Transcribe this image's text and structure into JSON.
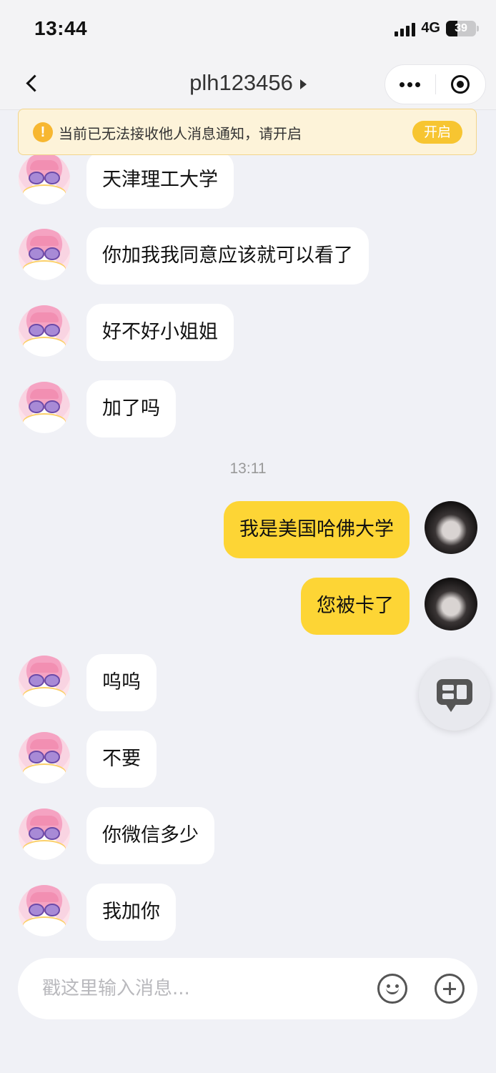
{
  "status_bar": {
    "time": "13:44",
    "network": "4G",
    "battery": "39"
  },
  "nav": {
    "title": "plh123456"
  },
  "notice": {
    "text": "当前已无法接收他人消息通知，请开启",
    "button": "开启"
  },
  "messages": [
    {
      "sender": "other",
      "text": "天津理工大学"
    },
    {
      "sender": "other",
      "text": "你加我我同意应该就可以看了"
    },
    {
      "sender": "other",
      "text": "好不好小姐姐"
    },
    {
      "sender": "other",
      "text": "加了吗"
    },
    {
      "sender": "self",
      "text": "我是美国哈佛大学"
    },
    {
      "sender": "self",
      "text": "您被卡了"
    },
    {
      "sender": "other",
      "text": "呜呜"
    },
    {
      "sender": "other",
      "text": "不要"
    },
    {
      "sender": "other",
      "text": "你微信多少"
    },
    {
      "sender": "other",
      "text": "我加你"
    }
  ],
  "time_divider": "13:11",
  "input": {
    "placeholder": "戳这里输入消息..."
  }
}
